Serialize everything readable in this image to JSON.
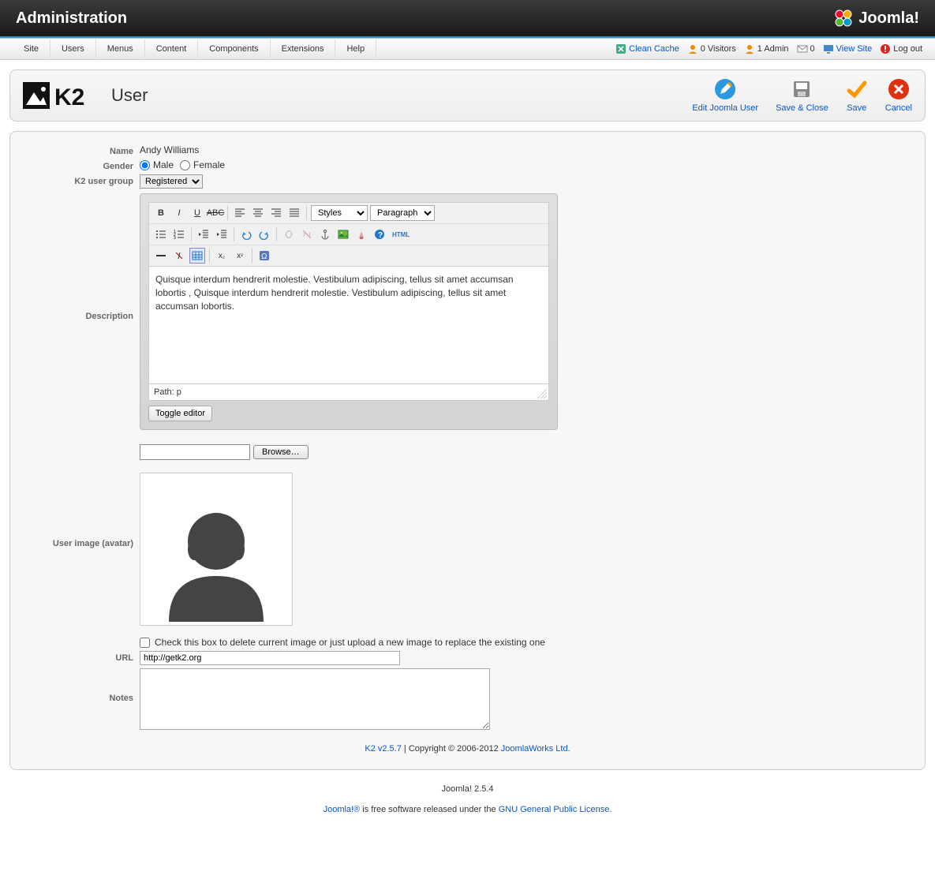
{
  "header": {
    "title": "Administration",
    "brand": "Joomla!"
  },
  "menubar": {
    "items": [
      "Site",
      "Users",
      "Menus",
      "Content",
      "Components",
      "Extensions",
      "Help"
    ],
    "status": {
      "clean_cache": "Clean Cache",
      "visitors": "0 Visitors",
      "admin": "1 Admin",
      "messages": "0",
      "view_site": "View Site",
      "log_out": "Log out"
    }
  },
  "toolbar": {
    "heading": "User",
    "actions": {
      "edit_joomla_user": "Edit Joomla User",
      "save_close": "Save & Close",
      "save": "Save",
      "cancel": "Cancel"
    }
  },
  "form": {
    "labels": {
      "name": "Name",
      "gender": "Gender",
      "group": "K2 user group",
      "description": "Description",
      "avatar": "User image (avatar)",
      "url": "URL",
      "notes": "Notes"
    },
    "name_value": "Andy Williams",
    "gender": {
      "male": "Male",
      "female": "Female",
      "selected": "male"
    },
    "group_options": [
      "Registered"
    ],
    "group_selected": "Registered",
    "editor": {
      "styles_label": "Styles",
      "format_label": "Paragraph",
      "html_label": "HTML",
      "content": "Quisque interdum hendrerit molestie. Vestibulum adipiscing, tellus sit amet accumsan lobortis , Quisque interdum hendrerit molestie. Vestibulum adipiscing, tellus sit amet accumsan lobortis.",
      "path": "Path: p",
      "toggle": "Toggle editor"
    },
    "avatar": {
      "browse": "Browse…",
      "delete_label": "Check this box to delete current image or just upload a new image to replace the existing one"
    },
    "url_value": "http://getk2.org",
    "notes_value": ""
  },
  "footer": {
    "version_link": "K2 v2.5.7",
    "copyright": " | Copyright © 2006-2012 ",
    "company": "JoomlaWorks Ltd.",
    "joomla_version": "Joomla! 2.5.4",
    "license_prefix": "Joomla!®",
    "license_mid": " is free software released under the ",
    "license_link": "GNU General Public License."
  }
}
